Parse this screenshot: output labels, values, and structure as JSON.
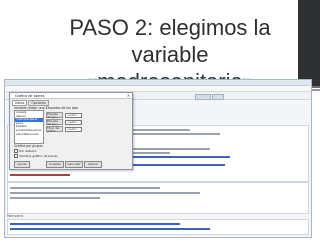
{
  "slide": {
    "title_line1": "PASO 2: elegimos la variable",
    "title_line2": "«madresanitaria»"
  },
  "dialog": {
    "title": "Gráfico de barras",
    "tabs": [
      "Datos",
      "Opciones"
    ],
    "variable_label": "Variable (elegir una)",
    "variables": [
      "anxiety",
      "depres",
      "madresanitaria",
      "peso",
      "tristeza",
      "promediobecarios",
      "valordiferencias"
    ],
    "selected_index": 2,
    "group_label": "Gráfico por grupos",
    "subset_label": "Expresión de selección",
    "options_label": "Etiquetas de los ejes",
    "fields": [
      {
        "button": "Etiqueta del eje x",
        "value": "<auto>"
      },
      {
        "button": "Etiqueta del eje y",
        "value": "<auto>"
      },
      {
        "button": "Título del gráfico",
        "value": "<auto>"
      }
    ],
    "checkboxes": [
      "Por defecto",
      "Nombre gráfico de barras"
    ],
    "buttons": [
      "Ayuda",
      "Aceptar",
      "Cancelar",
      "Aplicar"
    ]
  },
  "app": {
    "messages_label": "Mensajes"
  },
  "colors": {
    "selection": "#3875d7",
    "accent_bar": "#2f3031"
  }
}
